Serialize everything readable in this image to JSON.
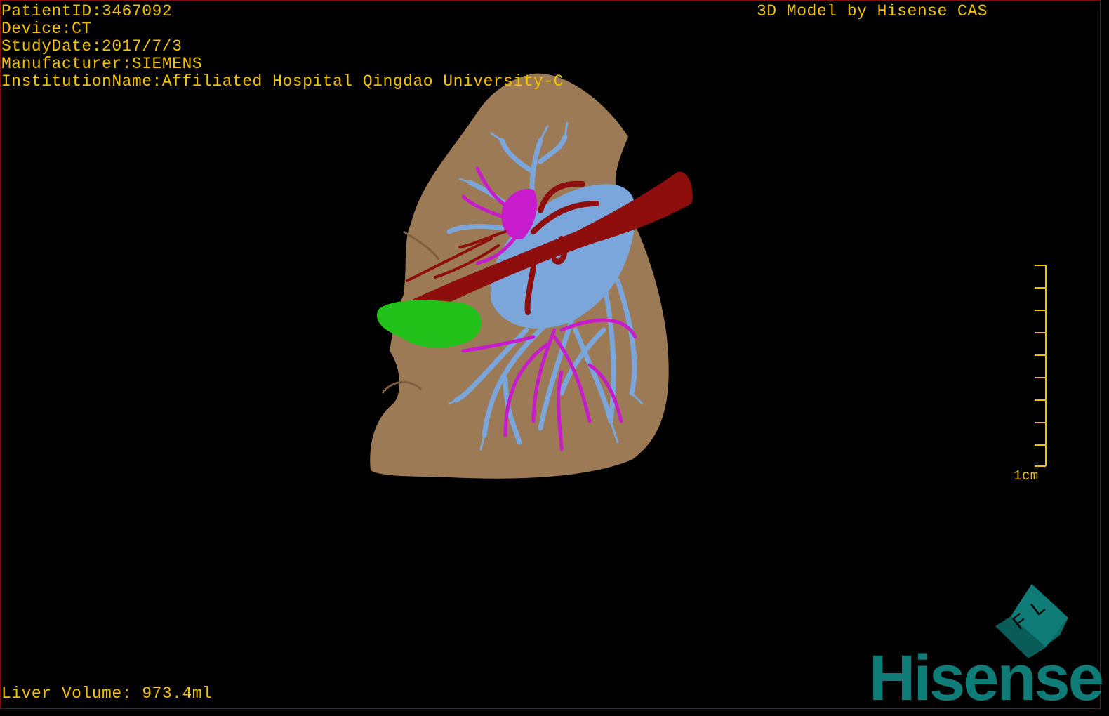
{
  "header": {
    "patient_id": "PatientID:3467092",
    "device": "Device:CT",
    "study_date": "StudyDate:2017/7/3",
    "manufacturer": "Manufacturer:SIEMENS",
    "institution": "InstitutionName:Affiliated Hospital Qingdao University-C",
    "model_credit": "3D Model by Hisense CAS"
  },
  "footer": {
    "liver_volume": "Liver Volume: 973.4ml"
  },
  "scale_bar": {
    "label": "1cm"
  },
  "brand": {
    "name": "Hisense",
    "cube_letters": "F L"
  },
  "colors": {
    "text": "#f2c200",
    "liver": "#9c7a55",
    "artery": "#8e0d0d",
    "portal_vein": "#7aa6dc",
    "hepatic_vein": "#c81ccc",
    "gallbladder": "#22c21a",
    "brand": "#0f7c78"
  }
}
